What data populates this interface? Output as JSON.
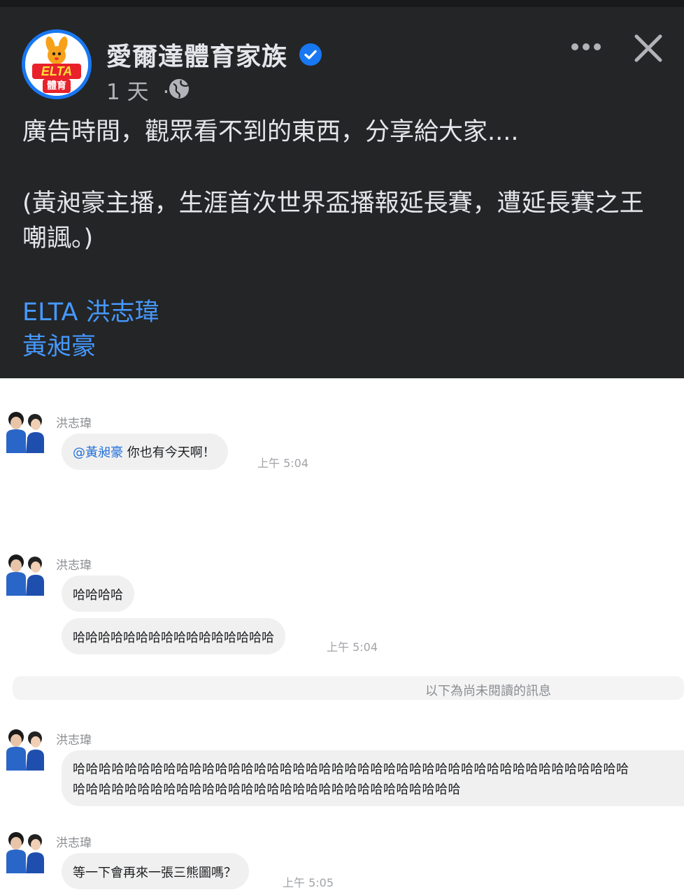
{
  "post": {
    "page_name": "愛爾達體育家族",
    "avatar_logo_text": "ELTA",
    "avatar_sub_text": "體育",
    "time": "1 天",
    "separator": "·",
    "text_line1": "廣告時間，觀眾看不到的東西，分享給大家....",
    "text_para2": "(黃昶豪主播，生涯首次世界盃播報延長賽，遭延長賽之王嘲諷。)",
    "tags": [
      "ELTA 洪志瑋",
      "黃昶豪"
    ],
    "colors": {
      "background": "#242526",
      "link": "#4599ff",
      "verified": "#1877f2"
    },
    "icons": [
      "verified-badge-icon",
      "globe-icon",
      "more-options-icon",
      "close-icon"
    ]
  },
  "chat": {
    "groups": [
      {
        "sender": "洪志瑋",
        "messages": [
          {
            "mention": "@黃昶豪",
            "text": " 你也有今天啊！"
          }
        ],
        "time": "上午 5:04"
      },
      {
        "sender": "洪志瑋",
        "messages": [
          {
            "text": "哈哈哈哈"
          },
          {
            "text": "哈哈哈哈哈哈哈哈哈哈哈哈哈哈哈哈"
          }
        ],
        "time": "上午 5:04"
      },
      {
        "sender": "洪志瑋",
        "messages": [
          {
            "line1": "哈哈哈哈哈哈哈哈哈哈哈哈哈哈哈哈哈哈哈哈哈哈哈哈哈哈哈哈哈哈哈哈哈哈哈哈哈哈哈哈哈哈哈",
            "line2": "哈哈哈哈哈哈哈哈哈哈哈哈哈哈哈哈哈哈哈哈哈哈哈哈哈哈哈哈哈哈"
          }
        ]
      },
      {
        "sender": "洪志瑋",
        "messages": [
          {
            "text": "等一下會再來一張三熊圖嗎？"
          }
        ],
        "time": "上午 5:05"
      }
    ],
    "unread_divider": "以下為尚未閱讀的訊息",
    "colors": {
      "bubble": "#f0f0f0",
      "mention": "#216fdb"
    }
  }
}
